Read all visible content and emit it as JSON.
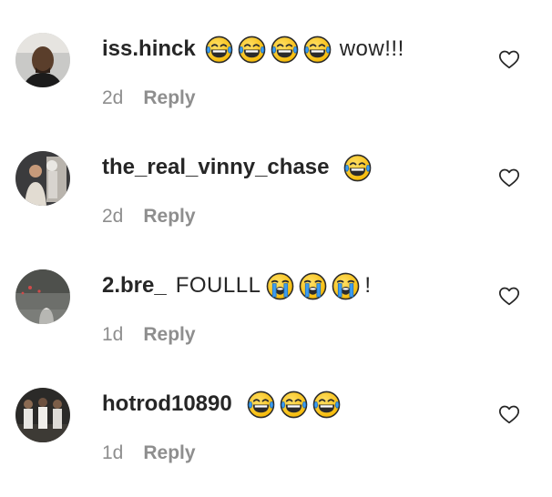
{
  "comments": [
    {
      "username": "iss.hinck",
      "text_before": "",
      "emojis_before": [
        "tears-of-joy",
        "tears-of-joy",
        "tears-of-joy",
        "tears-of-joy"
      ],
      "text": "wow!!!",
      "emojis_after": [],
      "time": "2d",
      "reply_label": "Reply",
      "like_icon": "heart-outline-icon"
    },
    {
      "username": "the_real_vinny_chase",
      "text_before": "",
      "emojis_before": [],
      "text": "",
      "emojis_after": [
        "tears-of-joy"
      ],
      "time": "2d",
      "reply_label": "Reply",
      "like_icon": "heart-outline-icon"
    },
    {
      "username": "2.bre_",
      "text_before": "FOULLL",
      "emojis_before": [],
      "text": "!",
      "emojis_after": [
        "loudly-crying",
        "loudly-crying",
        "loudly-crying"
      ],
      "time": "1d",
      "reply_label": "Reply",
      "like_icon": "heart-outline-icon"
    },
    {
      "username": "hotrod10890",
      "text_before": "",
      "emojis_before": [],
      "text": "",
      "emojis_after": [
        "tears-of-joy",
        "tears-of-joy",
        "tears-of-joy"
      ],
      "time": "1d",
      "reply_label": "Reply",
      "like_icon": "heart-outline-icon"
    }
  ],
  "colors": {
    "text": "#262626",
    "secondary": "#8e8e8e",
    "emoji_face": "#ffcc33",
    "emoji_tear": "#3d9cf0"
  }
}
